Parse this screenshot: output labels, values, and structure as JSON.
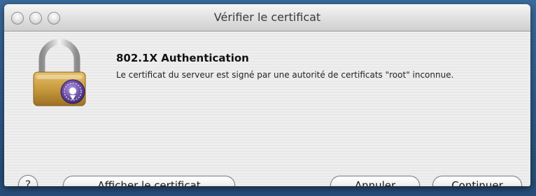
{
  "window": {
    "title": "Vérifier le certificat"
  },
  "dialog": {
    "heading": "802.1X Authentication",
    "message": "Le certificat du serveur est signé par une autorité de certificats \"root\" inconnue.",
    "icon": "lock-certificate-icon"
  },
  "buttons": {
    "help_label": "?",
    "show_certificate_label": "Afficher le certificat",
    "cancel_label": "Annuler",
    "continue_label": "Continuer"
  },
  "colors": {
    "window_bg": "#ececec",
    "lock_gold": "#c79a3d",
    "badge_purple": "#6a4fa3"
  }
}
